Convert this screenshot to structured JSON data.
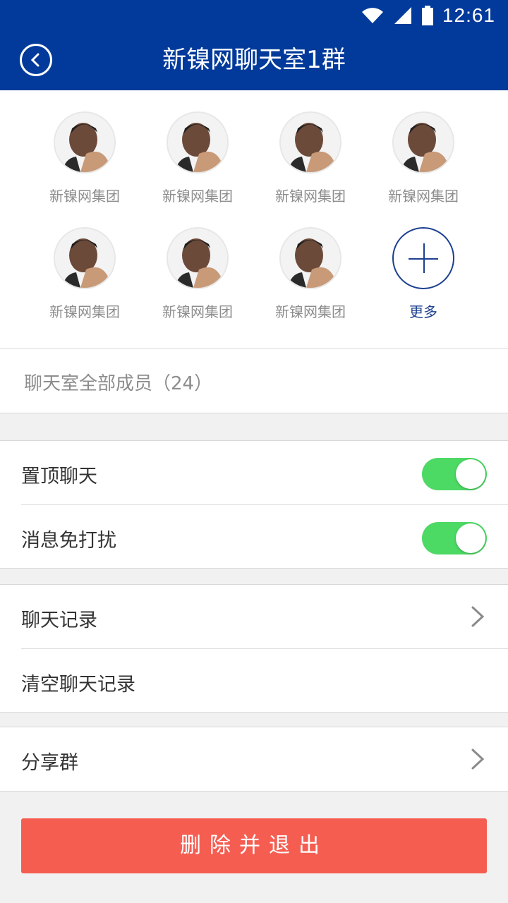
{
  "status": {
    "time": "12:61"
  },
  "header": {
    "title": "新镍网聊天室1群"
  },
  "members": [
    {
      "name": "新镍网集团"
    },
    {
      "name": "新镍网集团"
    },
    {
      "name": "新镍网集团"
    },
    {
      "name": "新镍网集团"
    },
    {
      "name": "新镍网集团"
    },
    {
      "name": "新镍网集团"
    },
    {
      "name": "新镍网集团"
    }
  ],
  "more_label": "更多",
  "all_members_label": "聊天室全部成员（24）",
  "settings": {
    "pin_chat": {
      "label": "置顶聊天",
      "enabled": true
    },
    "mute": {
      "label": "消息免打扰",
      "enabled": true
    },
    "chat_history": {
      "label": "聊天记录"
    },
    "clear_history": {
      "label": "清空聊天记录"
    },
    "share_group": {
      "label": "分享群"
    }
  },
  "delete_button": {
    "label": "删除并退出"
  },
  "colors": {
    "header": "#013a9a",
    "toggle_on": "#4cd964",
    "danger": "#f65d51",
    "accent": "#1c3f8f"
  }
}
